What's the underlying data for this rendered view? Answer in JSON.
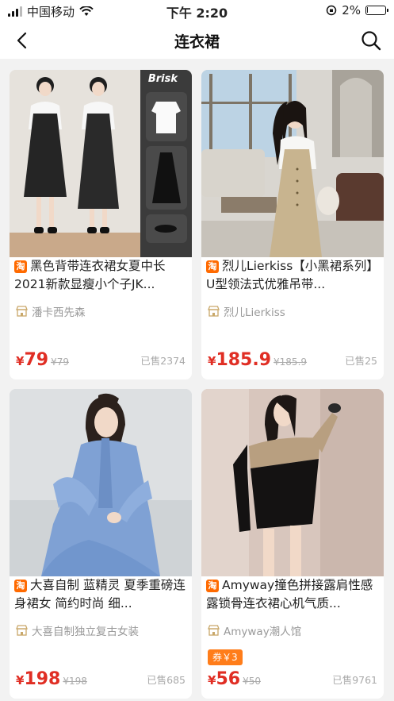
{
  "status_bar": {
    "carrier": "中国移动",
    "time": "下午 2:20",
    "battery": "2%"
  },
  "nav": {
    "title": "连衣裙"
  },
  "brand_tag": "淘",
  "products": [
    {
      "title": "黑色背带连衣裙女夏中长2021新款显瘦小个子JK...",
      "shop": "潘卡西先森",
      "currency": "¥",
      "price": "79",
      "original_price": "¥79",
      "sold": "已售2374",
      "image_overlay": "Brisk"
    },
    {
      "title": "烈儿Lierkiss【小黑裙系列】U型领法式优雅吊带...",
      "shop": "烈儿Lierkiss",
      "currency": "¥",
      "price": "185.9",
      "original_price": "¥185.9",
      "sold": "已售25"
    },
    {
      "title": "大喜自制 蓝精灵 夏季重磅连身裙女 简约时尚 细...",
      "shop": "大喜自制独立复古女装",
      "currency": "¥",
      "price": "198",
      "original_price": "¥198",
      "sold": "已售685"
    },
    {
      "title": "Amyway撞色拼接露肩性感露锁骨连衣裙心机气质...",
      "shop": "Amyway潮人馆",
      "coupon": "券￥3",
      "currency": "¥",
      "price": "56",
      "original_price": "¥50",
      "sold": "已售9761"
    }
  ]
}
